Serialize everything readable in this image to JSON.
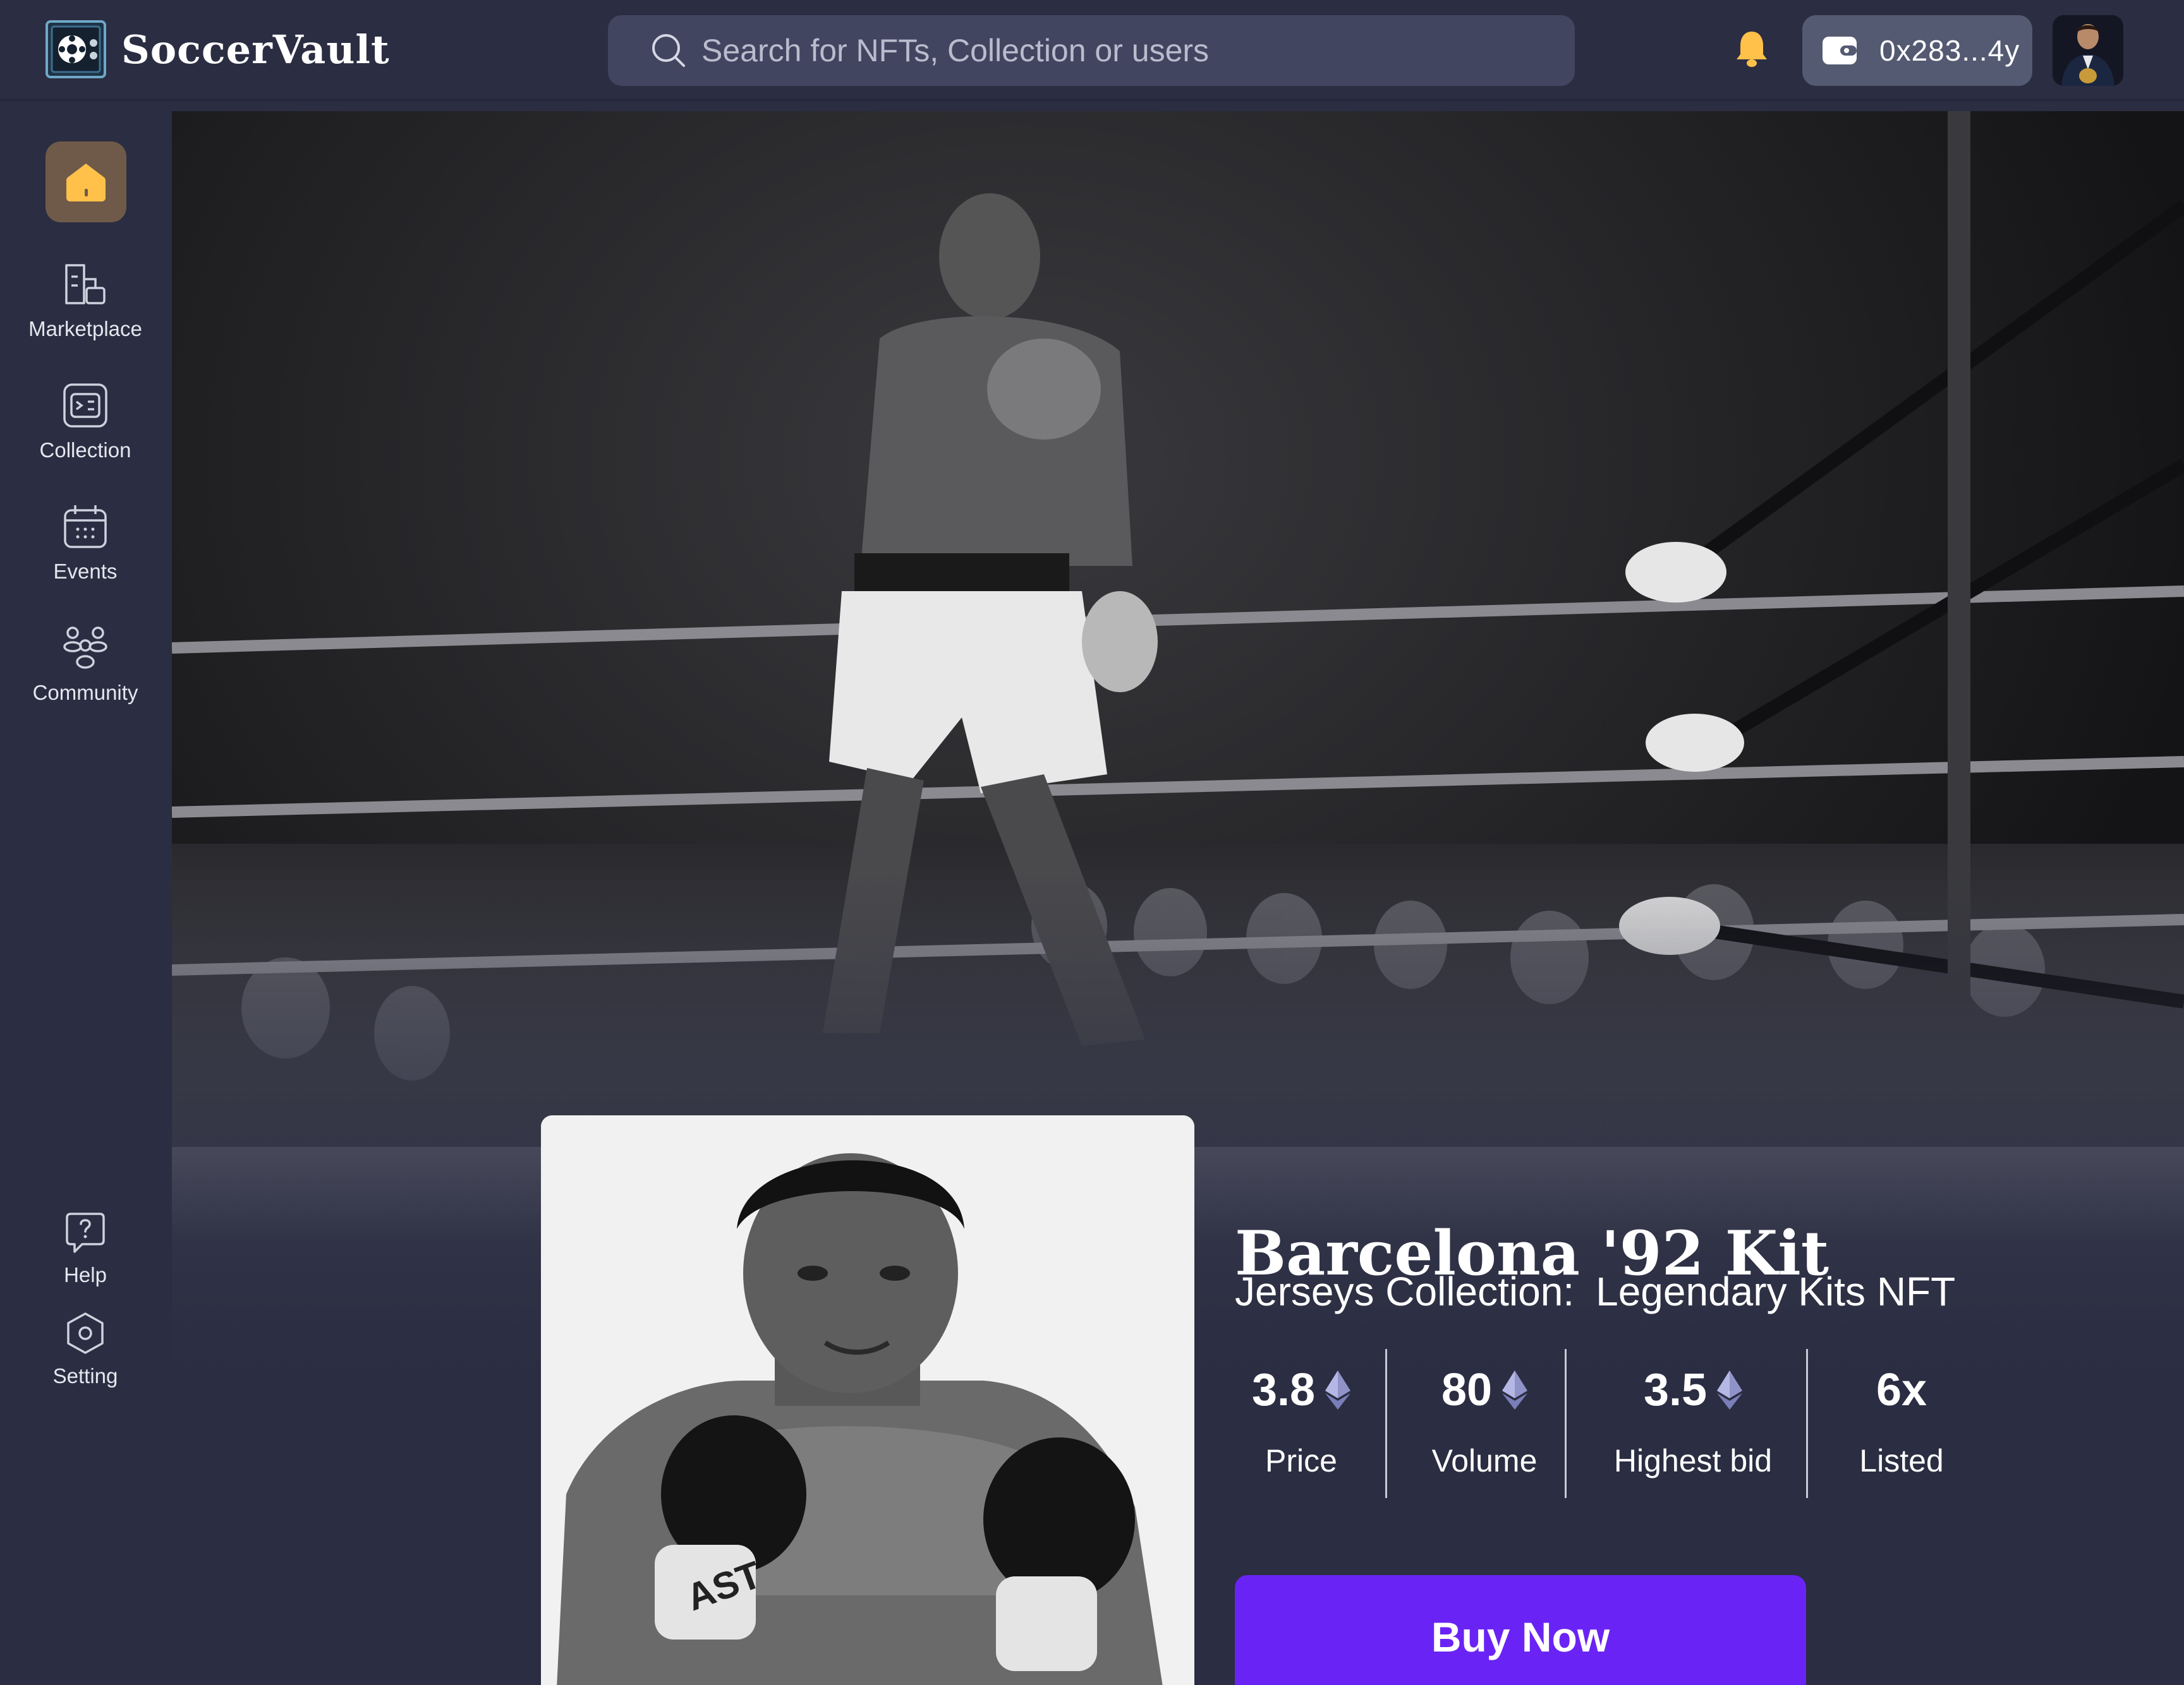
{
  "app": {
    "name": "SoccerVault"
  },
  "search": {
    "placeholder": "Search for NFTs, Collection or users"
  },
  "wallet": {
    "address": "0x283...4y"
  },
  "sidebar": {
    "items": [
      {
        "label": "Marketplace",
        "icon": "marketplace-icon"
      },
      {
        "label": "Collection",
        "icon": "collection-icon"
      },
      {
        "label": "Events",
        "icon": "calendar-icon"
      },
      {
        "label": "Community",
        "icon": "community-icon"
      }
    ],
    "bottom_items": [
      {
        "label": "Help",
        "icon": "help-icon"
      },
      {
        "label": "Setting",
        "icon": "settings-icon"
      }
    ]
  },
  "nft": {
    "title": "Barcelona '92 Kit",
    "collection_label": "Jerseys Collection:",
    "collection_name": "Legendary Kits NFT",
    "stats": [
      {
        "value": "3.8",
        "label": "Price",
        "currency": "eth-icon"
      },
      {
        "value": "80",
        "label": "Volume",
        "currency": "eth-icon"
      },
      {
        "value": "3.5",
        "label": "Highest bid",
        "currency": "eth-icon"
      },
      {
        "value": "6x",
        "label": "Listed"
      }
    ],
    "buy_label": "Buy Now"
  },
  "colors": {
    "background": "#2b2d42",
    "search_bg": "#414560",
    "wallet_bg": "#545a72",
    "home_button_bg": "#6f5a4a",
    "home_icon": "#ffc14a",
    "bell": "#ffc14a",
    "accent": "#6a23f5"
  }
}
